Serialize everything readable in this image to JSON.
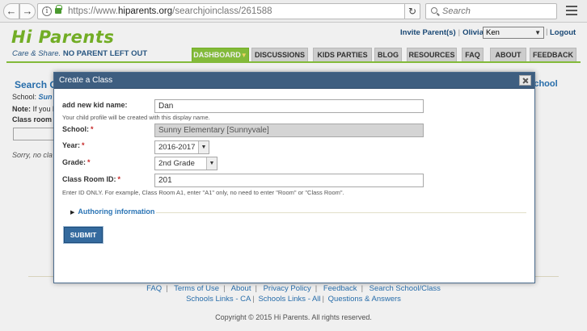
{
  "browser": {
    "url_prefix": "https://www.",
    "url_domain": "hiparents.org",
    "url_path": "/searchjoinclass/261588",
    "search_placeholder": "Search"
  },
  "header": {
    "logo": "Hi Parents",
    "tagline_prefix": "Care & Share.",
    "tagline_bold": "NO PARENT LEFT OUT",
    "invite": "Invite Parent(s)",
    "user_name": "Olivia",
    "user_select_value": "Ken",
    "logout": "Logout"
  },
  "nav": {
    "tabs": [
      {
        "label": "DASHBOARD",
        "active": true
      },
      {
        "label": "DISCUSSIONS"
      },
      {
        "label": "KIDS PARTIES"
      },
      {
        "label": "BLOG"
      },
      {
        "label": "RESOURCES"
      },
      {
        "label": "FAQ"
      },
      {
        "label": "ABOUT"
      },
      {
        "label": "FEEDBACK"
      }
    ]
  },
  "background": {
    "title": "Search C",
    "right_link": "School",
    "school_label": "School:",
    "school_value": "Sun",
    "note_label": "Note:",
    "note_text": "If you h",
    "class_label": "Class room",
    "empty_text": "Sorry, no cla"
  },
  "modal": {
    "title": "Create a Class",
    "kid_label": "add new kid name:",
    "kid_value": "Dan",
    "kid_help": "Your child profile will be created with this display name.",
    "school_label": "School:",
    "school_value": "Sunny Elementary [Sunnyvale]",
    "year_label": "Year:",
    "year_value": "2016-2017",
    "grade_label": "Grade:",
    "grade_value": "2nd Grade",
    "room_label": "Class Room ID:",
    "room_value": "201",
    "room_help": "Enter ID ONLY. For example, Class Room A1, enter \"A1\" only, no need to enter \"Room\" or \"Class Room\".",
    "required_mark": "*",
    "authoring": "Authoring information",
    "submit": "SUBMIT"
  },
  "footer": {
    "row1": [
      "FAQ",
      "Terms of Use",
      "About",
      "Privacy Policy",
      "Feedback",
      "Search School/Class"
    ],
    "row2": [
      "Schools Links - CA",
      "Schools Links - All",
      "Questions & Answers"
    ],
    "copyright": "Copyright © 2015 Hi Parents. All rights reserved."
  },
  "colors": {
    "brand_green": "#8cc63e",
    "link_blue": "#2a74b5",
    "modal_header": "#3e5e80",
    "submit_blue": "#346a9e"
  }
}
